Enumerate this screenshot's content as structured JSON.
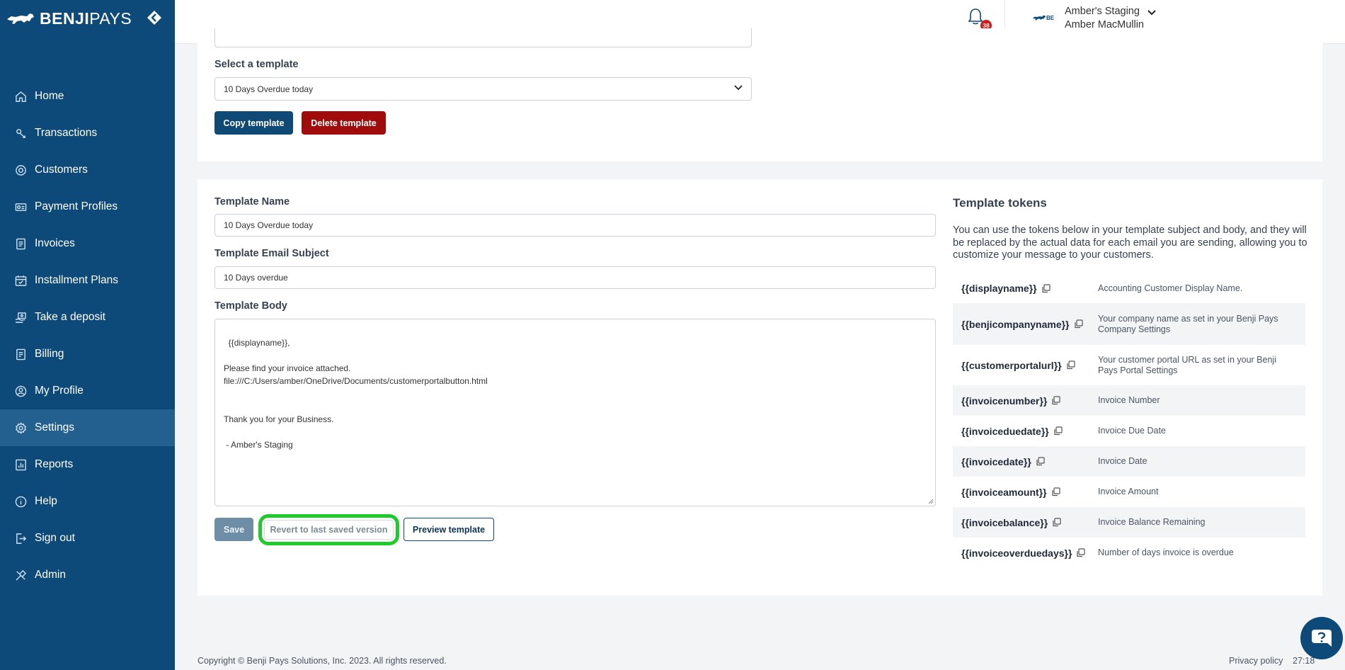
{
  "brand": {
    "name_bold": "BENJI",
    "name_light": "PAYS"
  },
  "sidebar": {
    "items": [
      {
        "label": "Home",
        "icon": "home-icon"
      },
      {
        "label": "Transactions",
        "icon": "transactions-icon"
      },
      {
        "label": "Customers",
        "icon": "customers-icon"
      },
      {
        "label": "Payment Profiles",
        "icon": "payment-profiles-icon"
      },
      {
        "label": "Invoices",
        "icon": "invoices-icon"
      },
      {
        "label": "Installment Plans",
        "icon": "calendar-icon"
      },
      {
        "label": "Take a deposit",
        "icon": "deposit-icon"
      },
      {
        "label": "Billing",
        "icon": "billing-icon"
      },
      {
        "label": "My Profile",
        "icon": "profile-icon"
      },
      {
        "label": "Settings",
        "icon": "gear-icon",
        "active": true
      },
      {
        "label": "Reports",
        "icon": "reports-icon"
      },
      {
        "label": "Help",
        "icon": "help-icon"
      },
      {
        "label": "Sign out",
        "icon": "sign-out-icon"
      },
      {
        "label": "Admin",
        "icon": "admin-icon"
      }
    ]
  },
  "topbar": {
    "notification_count": "38",
    "account_company": "Amber's Staging",
    "account_user": "Amber MacMullin",
    "mini_logo_text": "BE"
  },
  "template_select": {
    "label": "Select a template",
    "selected": "10 Days Overdue today",
    "copy_label": "Copy template",
    "delete_label": "Delete template"
  },
  "editor": {
    "name_label": "Template Name",
    "name_value": "10 Days Overdue today",
    "subject_label": "Template Email Subject",
    "subject_value": "10 Days overdue",
    "body_label": "Template Body",
    "body_value": "{{displayname}},\n\nPlease find your invoice attached.\nfile:///C:/Users/amber/OneDrive/Documents/customerportalbutton.html\n\n\nThank you for your Business.\n\n - Amber's Staging",
    "save_label": "Save",
    "revert_label": "Revert to last saved version",
    "preview_label": "Preview template"
  },
  "tokens": {
    "title": "Template tokens",
    "description": "You can use the tokens below in your template subject and body, and they will be replaced by the actual data for each email you are sending, allowing you to customize your message to your customers.",
    "rows": [
      {
        "token": "{{displayname}}",
        "desc": "Accounting Customer Display Name."
      },
      {
        "token": "{{benjicompanyname}}",
        "desc": "Your company name as set in your Benji Pays Company Settings"
      },
      {
        "token": "{{customerportalurl}}",
        "desc": "Your customer portal URL as set in your Benji Pays Portal Settings"
      },
      {
        "token": "{{invoicenumber}}",
        "desc": "Invoice Number"
      },
      {
        "token": "{{invoiceduedate}}",
        "desc": "Invoice Due Date"
      },
      {
        "token": "{{invoicedate}}",
        "desc": "Invoice Date"
      },
      {
        "token": "{{invoiceamount}}",
        "desc": "Invoice Amount"
      },
      {
        "token": "{{invoicebalance}}",
        "desc": "Invoice Balance Remaining"
      },
      {
        "token": "{{invoiceoverduedays}}",
        "desc": "Number of days invoice is overdue"
      }
    ]
  },
  "footer": {
    "copyright": "Copyright © Benji Pays Solutions, Inc. 2023. All rights reserved.",
    "privacy": "Privacy policy",
    "time": "27:18"
  },
  "colors": {
    "sidebar": "#0d4a7a",
    "sidebar_active": "#23608f",
    "primary": "#0e4a75",
    "danger": "#a00b0b",
    "highlight": "#1ecb2b"
  }
}
